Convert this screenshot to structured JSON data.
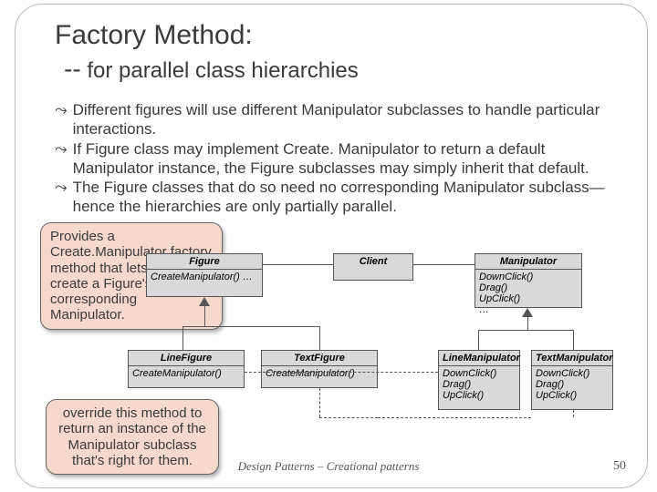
{
  "title": {
    "line1": "Factory Method:",
    "line2_dash": "--",
    "line2_rest": " for parallel class hierarchies"
  },
  "bullets": [
    "Different figures will use different Manipulator subclasses to handle particular interactions.",
    "If Figure class may implement Create. Manipulator to return a default Manipulator instance, the Figure subclasses may simply inherit that default.",
    "The Figure classes that do so need no corresponding Manipulator subclass—hence the hierarchies are only partially parallel."
  ],
  "callouts": {
    "top": "Provides a Create.Manipulator factory method that lets clients create a Figure's corresponding Manipulator.",
    "bottom": "override this method to return an instance of the Manipulator subclass that's right for them."
  },
  "diagram": {
    "figure": {
      "name": "Figure",
      "ops": "CreateManipulator()\n…"
    },
    "client": {
      "name": "Client"
    },
    "manipulator": {
      "name": "Manipulator",
      "ops": "DownClick()\nDrag()\nUpClick()\n…"
    },
    "linefigure": {
      "name": "LineFigure",
      "ops": "CreateManipulator()"
    },
    "textfigure": {
      "name": "TextFigure",
      "ops": "CreateManipulator()"
    },
    "linemanipulator": {
      "name": "LineManipulator",
      "ops": "DownClick()\nDrag()\nUpClick()"
    },
    "textmanipulator": {
      "name": "TextManipulator",
      "ops": "DownClick()\nDrag()\nUpClick()"
    }
  },
  "footer": "Design Patterns – Creational patterns",
  "page": "50"
}
